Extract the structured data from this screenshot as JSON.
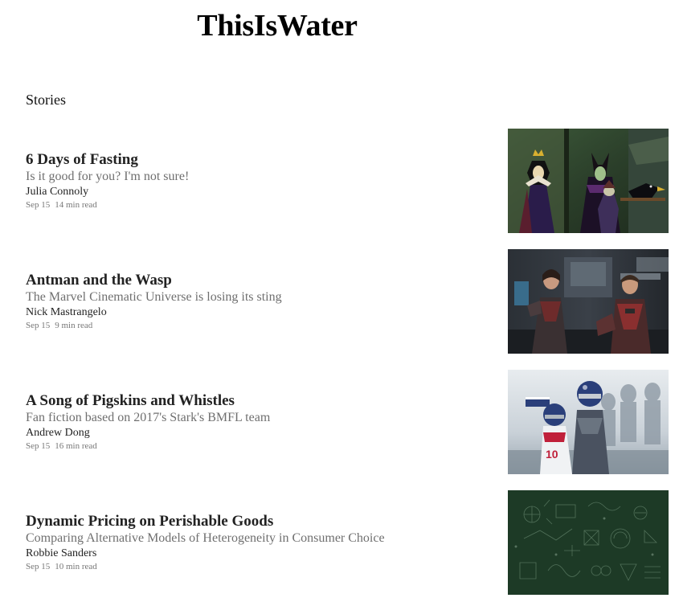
{
  "site": {
    "title": "ThisIsWater"
  },
  "section": {
    "heading": "Stories"
  },
  "stories": [
    {
      "title": "6 Days of Fasting",
      "subtitle": "Is it good for you? I'm not sure!",
      "author": "Julia Connoly",
      "date": "Sep 15",
      "read_time": "14 min read",
      "image": "villains-cartoon-image"
    },
    {
      "title": "Antman and the Wasp",
      "subtitle": "The Marvel Cinematic Universe is losing its sting",
      "author": "Nick Mastrangelo",
      "date": "Sep 15",
      "read_time": "9 min read",
      "image": "superheroes-movie-still-image"
    },
    {
      "title": "A Song of Pigskins and Whistles",
      "subtitle": "Fan fiction based on 2017's Stark's BMFL team",
      "author": "Andrew Dong",
      "date": "Sep 15",
      "read_time": "16 min read",
      "image": "football-players-image"
    },
    {
      "title": "Dynamic Pricing on Perishable Goods",
      "subtitle": "Comparing Alternative Models of Heterogeneity in Consumer Choice",
      "author": "Robbie Sanders",
      "date": "Sep 15",
      "read_time": "10 min read",
      "image": "chalkboard-doodles-image"
    }
  ],
  "colors": {
    "title": "#000000",
    "story_title": "#222222",
    "subtitle": "#6f6f6f",
    "meta": "#777777"
  }
}
